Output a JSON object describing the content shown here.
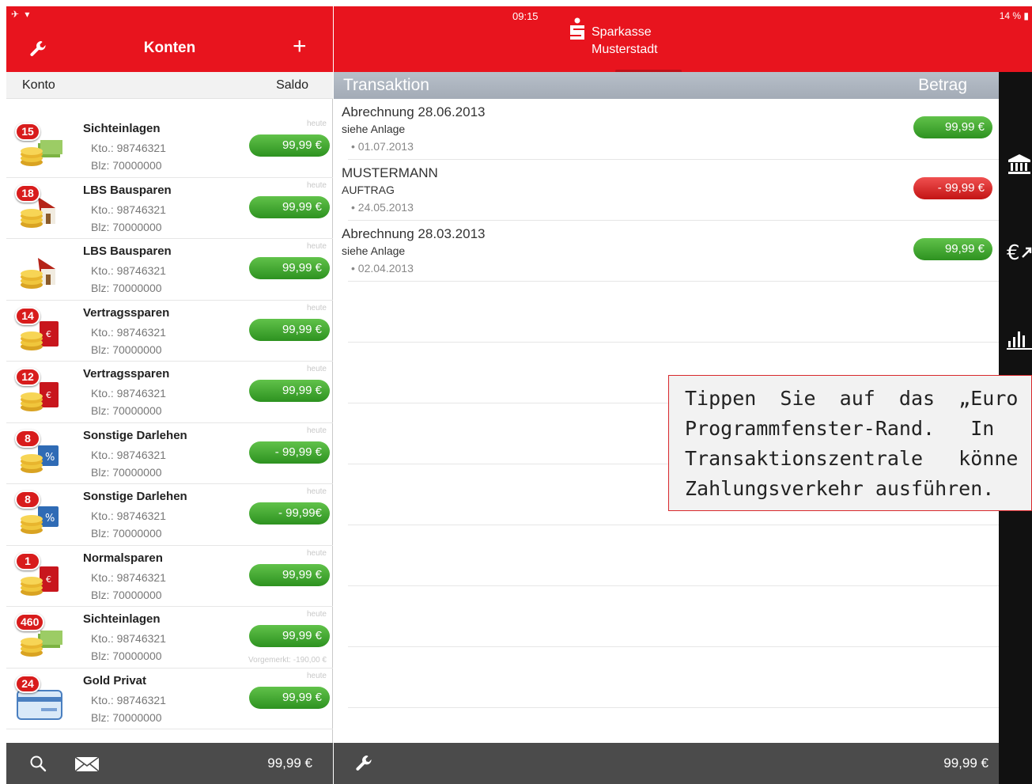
{
  "status": {
    "left": "✈ ▾",
    "time": "09:15",
    "battery": "14 % ▮"
  },
  "accounts_panel": {
    "title": "Konten",
    "add_label": "+",
    "col_konto": "Konto",
    "col_saldo": "Saldo",
    "accounts": [
      {
        "badge": "15",
        "name": "Sichteinlagen",
        "kto": "Kto.: 98746321",
        "blz": "Blz: 70000000",
        "heute": "heute",
        "amount": "99,99 €",
        "negative": false,
        "icon": "coins-money-icon"
      },
      {
        "badge": "18",
        "name": "LBS Bausparen",
        "kto": "Kto.: 98746321",
        "blz": "Blz: 70000000",
        "heute": "heute",
        "amount": "99,99 €",
        "negative": false,
        "icon": "house-coins-icon"
      },
      {
        "badge": "",
        "name": "LBS Bausparen",
        "kto": "Kto.: 98746321",
        "blz": "Blz: 70000000",
        "heute": "heute",
        "amount": "99,99 €",
        "negative": false,
        "icon": "house-coins-icon"
      },
      {
        "badge": "14",
        "name": "Vertragssparen",
        "kto": "Kto.: 98746321",
        "blz": "Blz: 70000000",
        "heute": "heute",
        "amount": "99,99 €",
        "negative": false,
        "icon": "red-book-coins-icon"
      },
      {
        "badge": "12",
        "name": "Vertragssparen",
        "kto": "Kto.: 98746321",
        "blz": "Blz: 70000000",
        "heute": "heute",
        "amount": "99,99 €",
        "negative": false,
        "icon": "red-book-coins-icon"
      },
      {
        "badge": "8",
        "name": "Sonstige Darlehen",
        "kto": "Kto.: 98746321",
        "blz": "Blz: 70000000",
        "heute": "heute",
        "amount": "- 99,99 €",
        "negative": false,
        "icon": "percent-coins-icon"
      },
      {
        "badge": "8",
        "name": "Sonstige Darlehen",
        "kto": "Kto.: 98746321",
        "blz": "Blz: 70000000",
        "heute": "heute",
        "amount": "- 99,99€",
        "negative": false,
        "icon": "percent-coins-icon"
      },
      {
        "badge": "1",
        "name": "Normalsparen",
        "kto": "Kto.: 98746321",
        "blz": "Blz: 70000000",
        "heute": "heute",
        "amount": "99,99 €",
        "negative": false,
        "icon": "red-book-coins-icon"
      },
      {
        "badge": "460",
        "name": "Sichteinlagen",
        "kto": "Kto.: 98746321",
        "blz": "Blz: 70000000",
        "heute": "heute",
        "amount": "99,99 €",
        "negative": false,
        "icon": "coins-money-icon",
        "note": "Vorgemerkt: -190,00 €"
      },
      {
        "badge": "24",
        "name": "Gold Privat",
        "kto": "Kto.: 98746321",
        "blz": "Blz: 70000000",
        "heute": "heute",
        "amount": "99,99 €",
        "negative": false,
        "icon": "credit-card-icon"
      }
    ],
    "footer_total": "99,99 €"
  },
  "transactions_panel": {
    "bank_name": "Sparkasse",
    "bank_city": "Musterstadt",
    "col_transaktion": "Transaktion",
    "col_betrag": "Betrag",
    "transactions": [
      {
        "title": "Abrechnung 28.06.2013",
        "sub": "siehe Anlage",
        "date": "01.07.2013",
        "amount": "99,99 €",
        "negative": false
      },
      {
        "title": "MUSTERMANN",
        "sub": "AUFTRAG",
        "date": "24.05.2013",
        "amount": "- 99,99 €",
        "negative": true
      },
      {
        "title": "Abrechnung 28.03.2013",
        "sub": "siehe Anlage",
        "date": "02.04.2013",
        "amount": "99,99 €",
        "negative": false
      }
    ],
    "footer_total": "99,99 €"
  },
  "callout": {
    "line1": "Tippen  Sie  auf  das  „Euro",
    "line2": "Programmfenster-Rand.   In",
    "line3": "Transaktionszentrale   könne",
    "line4": "Zahlungsverkehr ausführen."
  },
  "colors": {
    "brand_red": "#e8141e",
    "positive": "#3aa52b",
    "negative": "#d81c1c"
  }
}
